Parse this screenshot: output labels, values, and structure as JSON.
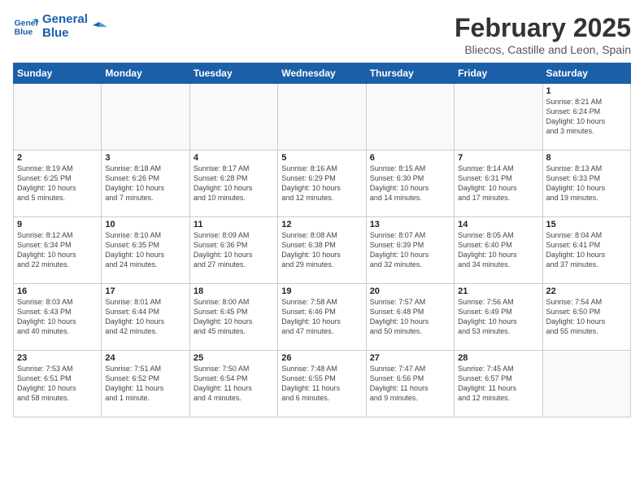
{
  "logo": {
    "line1": "General",
    "line2": "Blue"
  },
  "title": "February 2025",
  "subtitle": "Bliecos, Castille and Leon, Spain",
  "headers": [
    "Sunday",
    "Monday",
    "Tuesday",
    "Wednesday",
    "Thursday",
    "Friday",
    "Saturday"
  ],
  "weeks": [
    [
      {
        "day": "",
        "info": ""
      },
      {
        "day": "",
        "info": ""
      },
      {
        "day": "",
        "info": ""
      },
      {
        "day": "",
        "info": ""
      },
      {
        "day": "",
        "info": ""
      },
      {
        "day": "",
        "info": ""
      },
      {
        "day": "1",
        "info": "Sunrise: 8:21 AM\nSunset: 6:24 PM\nDaylight: 10 hours\nand 3 minutes."
      }
    ],
    [
      {
        "day": "2",
        "info": "Sunrise: 8:19 AM\nSunset: 6:25 PM\nDaylight: 10 hours\nand 5 minutes."
      },
      {
        "day": "3",
        "info": "Sunrise: 8:18 AM\nSunset: 6:26 PM\nDaylight: 10 hours\nand 7 minutes."
      },
      {
        "day": "4",
        "info": "Sunrise: 8:17 AM\nSunset: 6:28 PM\nDaylight: 10 hours\nand 10 minutes."
      },
      {
        "day": "5",
        "info": "Sunrise: 8:16 AM\nSunset: 6:29 PM\nDaylight: 10 hours\nand 12 minutes."
      },
      {
        "day": "6",
        "info": "Sunrise: 8:15 AM\nSunset: 6:30 PM\nDaylight: 10 hours\nand 14 minutes."
      },
      {
        "day": "7",
        "info": "Sunrise: 8:14 AM\nSunset: 6:31 PM\nDaylight: 10 hours\nand 17 minutes."
      },
      {
        "day": "8",
        "info": "Sunrise: 8:13 AM\nSunset: 6:33 PM\nDaylight: 10 hours\nand 19 minutes."
      }
    ],
    [
      {
        "day": "9",
        "info": "Sunrise: 8:12 AM\nSunset: 6:34 PM\nDaylight: 10 hours\nand 22 minutes."
      },
      {
        "day": "10",
        "info": "Sunrise: 8:10 AM\nSunset: 6:35 PM\nDaylight: 10 hours\nand 24 minutes."
      },
      {
        "day": "11",
        "info": "Sunrise: 8:09 AM\nSunset: 6:36 PM\nDaylight: 10 hours\nand 27 minutes."
      },
      {
        "day": "12",
        "info": "Sunrise: 8:08 AM\nSunset: 6:38 PM\nDaylight: 10 hours\nand 29 minutes."
      },
      {
        "day": "13",
        "info": "Sunrise: 8:07 AM\nSunset: 6:39 PM\nDaylight: 10 hours\nand 32 minutes."
      },
      {
        "day": "14",
        "info": "Sunrise: 8:05 AM\nSunset: 6:40 PM\nDaylight: 10 hours\nand 34 minutes."
      },
      {
        "day": "15",
        "info": "Sunrise: 8:04 AM\nSunset: 6:41 PM\nDaylight: 10 hours\nand 37 minutes."
      }
    ],
    [
      {
        "day": "16",
        "info": "Sunrise: 8:03 AM\nSunset: 6:43 PM\nDaylight: 10 hours\nand 40 minutes."
      },
      {
        "day": "17",
        "info": "Sunrise: 8:01 AM\nSunset: 6:44 PM\nDaylight: 10 hours\nand 42 minutes."
      },
      {
        "day": "18",
        "info": "Sunrise: 8:00 AM\nSunset: 6:45 PM\nDaylight: 10 hours\nand 45 minutes."
      },
      {
        "day": "19",
        "info": "Sunrise: 7:58 AM\nSunset: 6:46 PM\nDaylight: 10 hours\nand 47 minutes."
      },
      {
        "day": "20",
        "info": "Sunrise: 7:57 AM\nSunset: 6:48 PM\nDaylight: 10 hours\nand 50 minutes."
      },
      {
        "day": "21",
        "info": "Sunrise: 7:56 AM\nSunset: 6:49 PM\nDaylight: 10 hours\nand 53 minutes."
      },
      {
        "day": "22",
        "info": "Sunrise: 7:54 AM\nSunset: 6:50 PM\nDaylight: 10 hours\nand 55 minutes."
      }
    ],
    [
      {
        "day": "23",
        "info": "Sunrise: 7:53 AM\nSunset: 6:51 PM\nDaylight: 10 hours\nand 58 minutes."
      },
      {
        "day": "24",
        "info": "Sunrise: 7:51 AM\nSunset: 6:52 PM\nDaylight: 11 hours\nand 1 minute."
      },
      {
        "day": "25",
        "info": "Sunrise: 7:50 AM\nSunset: 6:54 PM\nDaylight: 11 hours\nand 4 minutes."
      },
      {
        "day": "26",
        "info": "Sunrise: 7:48 AM\nSunset: 6:55 PM\nDaylight: 11 hours\nand 6 minutes."
      },
      {
        "day": "27",
        "info": "Sunrise: 7:47 AM\nSunset: 6:56 PM\nDaylight: 11 hours\nand 9 minutes."
      },
      {
        "day": "28",
        "info": "Sunrise: 7:45 AM\nSunset: 6:57 PM\nDaylight: 11 hours\nand 12 minutes."
      },
      {
        "day": "",
        "info": ""
      }
    ]
  ]
}
